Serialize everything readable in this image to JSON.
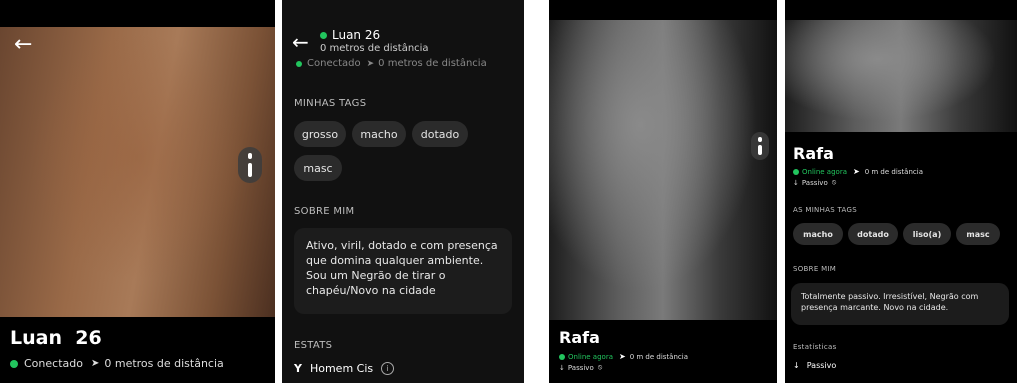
{
  "screen1": {
    "name": "Luan",
    "age": "26",
    "status": "Conectado",
    "distance": "0 metros de distância"
  },
  "screen2": {
    "header_name": "Luan 26",
    "header_distance": "0 metros de distância",
    "header_status": "Conectado",
    "header_distance_repeat": "0 metros de distância",
    "tags_title": "MINHAS TAGS",
    "tags": [
      "grosso",
      "macho",
      "dotado",
      "masc"
    ],
    "about_title": "SOBRE MIM",
    "about_text": "Ativo, viril, dotado e com presença que domina qualquer ambiente. Sou um Negrão de tirar o chapéu/Novo na cidade",
    "stats_title": "ESTATS",
    "stat_gender": "Homem Cis"
  },
  "screen3": {
    "name": "Rafa",
    "status": "Online agora",
    "distance": "0 m de distância",
    "position": "Passivo"
  },
  "screen4": {
    "name": "Rafa",
    "status": "Online agora",
    "distance": "0 m de distância",
    "position": "Passivo",
    "tags_title": "AS MINHAS TAGS",
    "tags": [
      "macho",
      "dotado",
      "liso(a)",
      "masc"
    ],
    "about_title": "SOBRE MIM",
    "about_text": "Totalmente passivo. Irresistível, Negrão com presença marcante. Novo na cidade.",
    "stats_title": "Estatísticas",
    "stat_position": "Passivo"
  },
  "colors": {
    "online": "#22c55e",
    "tag_bg": "#2b2b2b",
    "card_bg": "#1c1c1c",
    "background": "#000000"
  },
  "icons": [
    "back-arrow-icon",
    "location-arrow-icon",
    "scroll-handle-icon",
    "info-icon",
    "gender-icon",
    "arrow-down-icon",
    "no-icon"
  ]
}
